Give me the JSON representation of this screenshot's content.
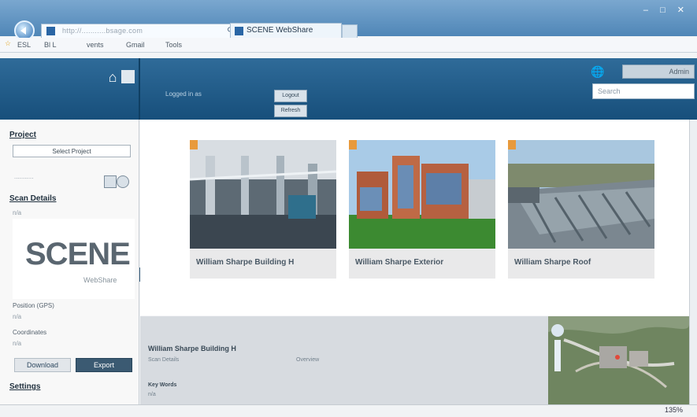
{
  "browser": {
    "address_text": "http://...........bsage.com",
    "tab_title": "SCENE WebShare",
    "window_controls": "– □ ✕",
    "favorites": [
      "☆",
      "ESL",
      "Bl L",
      "vents",
      "Gmail",
      "Tools"
    ],
    "zoom_level": "135%"
  },
  "header": {
    "label": "Logged in as",
    "button_1": "Logout",
    "button_2": "Refresh",
    "top_button": "Admin",
    "search_placeholder": "Search"
  },
  "sidebar": {
    "project_title": "Project",
    "select_label": "Select Project",
    "scan_details_title": "Scan Details",
    "logo_text": "SCENE",
    "logo_subtext": "WebShare",
    "position_label": "Position (GPS)",
    "coordinates_label": "Coordinates",
    "value_na_1": "n/a",
    "value_na_2": "n/a",
    "value_na_3": "n/a",
    "download_btn_1": "Download",
    "download_btn_2": "Export",
    "settings_title": "Settings"
  },
  "cards": [
    {
      "title": "William Sharpe Building H"
    },
    {
      "title": "William Sharpe Exterior"
    },
    {
      "title": "William Sharpe Roof"
    }
  ],
  "bottom": {
    "title": "William Sharpe Building H",
    "meta_left": "Scan Details",
    "meta_right": "Overview",
    "kv": "Key Words",
    "kv_value": "n/a"
  },
  "colors": {
    "header": "#1f5a87",
    "accent": "#e89a3c",
    "link": "#1f2f3d"
  }
}
